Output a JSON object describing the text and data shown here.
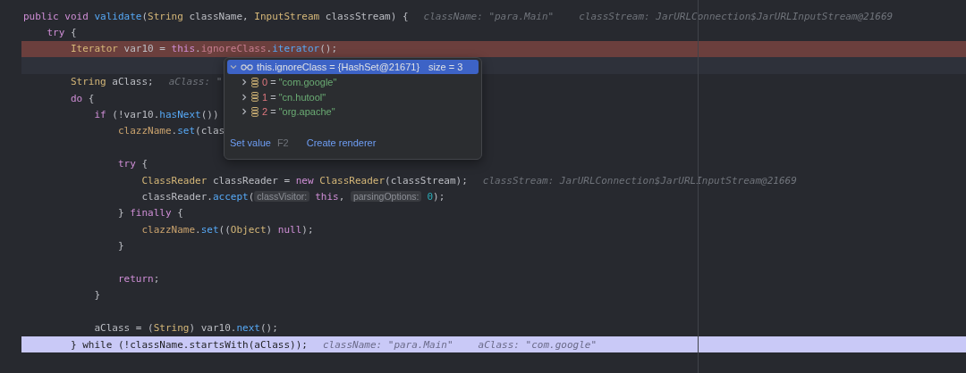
{
  "editor": {
    "lines": [
      {
        "kind": "code",
        "tokens": [
          {
            "kind": "keyword",
            "text": "public void "
          },
          {
            "kind": "method",
            "text": "validate"
          },
          {
            "kind": "plain",
            "text": "("
          },
          {
            "kind": "type",
            "text": "String"
          },
          {
            "kind": "plain",
            "text": " className, "
          },
          {
            "kind": "type",
            "text": "InputStream"
          },
          {
            "kind": "plain",
            "text": " classStream) {"
          }
        ],
        "hints": [
          "className: \"para.Main\"",
          "classStream: JarURLConnection$JarURLInputStream@21669"
        ],
        "children": [
          {
            "kind": "code",
            "tokens": [
              {
                "kind": "keyword",
                "text": "try"
              },
              {
                "kind": "plain",
                "text": " {"
              }
            ],
            "children": [
              {
                "kind": "breakpoint",
                "tokens": [
                  {
                    "kind": "type",
                    "text": "Iterator"
                  },
                  {
                    "kind": "plain",
                    "text": " var10 = "
                  },
                  {
                    "kind": "keyword",
                    "text": "this"
                  },
                  {
                    "kind": "plain",
                    "text": "."
                  },
                  {
                    "kind": "field",
                    "text": "ignoreClass"
                  },
                  {
                    "kind": "plain",
                    "text": "."
                  },
                  {
                    "kind": "method",
                    "text": "iterator"
                  },
                  {
                    "kind": "plain",
                    "text": "();"
                  }
                ]
              },
              {
                "kind": "current"
              },
              {
                "kind": "code",
                "tokens": [
                  {
                    "kind": "type",
                    "text": "String"
                  },
                  {
                    "kind": "plain",
                    "text": " aClass;"
                  }
                ],
                "hints": [
                  "aClass: \""
                ]
              },
              {
                "kind": "code",
                "tokens": [
                  {
                    "kind": "keyword",
                    "text": "do"
                  },
                  {
                    "kind": "plain",
                    "text": " {"
                  }
                ],
                "children": [
                  {
                    "kind": "code",
                    "tokens": [
                      {
                        "kind": "keyword",
                        "text": "if"
                      },
                      {
                        "kind": "plain",
                        "text": " (!var10."
                      },
                      {
                        "kind": "method",
                        "text": "hasNext"
                      },
                      {
                        "kind": "plain",
                        "text": "())"
                      }
                    ],
                    "children": [
                      {
                        "kind": "code",
                        "tokens": [
                          {
                            "kind": "static",
                            "text": "clazzName"
                          },
                          {
                            "kind": "plain",
                            "text": "."
                          },
                          {
                            "kind": "method",
                            "text": "set"
                          },
                          {
                            "kind": "plain",
                            "text": "(clas"
                          }
                        ]
                      },
                      {
                        "kind": "blank"
                      },
                      {
                        "kind": "code",
                        "tokens": [
                          {
                            "kind": "keyword",
                            "text": "try"
                          },
                          {
                            "kind": "plain",
                            "text": " {"
                          }
                        ],
                        "children": [
                          {
                            "kind": "code",
                            "tokens": [
                              {
                                "kind": "type",
                                "text": "ClassReader"
                              },
                              {
                                "kind": "plain",
                                "text": " classReader = "
                              },
                              {
                                "kind": "keyword",
                                "text": "new "
                              },
                              {
                                "kind": "type",
                                "text": "ClassReader"
                              },
                              {
                                "kind": "plain",
                                "text": "(classStream);"
                              }
                            ],
                            "hints": [
                              "classStream: JarURLConnection$JarURLInputStream@21669"
                            ]
                          },
                          {
                            "kind": "code",
                            "tokens": [
                              {
                                "kind": "plain",
                                "text": "classReader."
                              },
                              {
                                "kind": "method",
                                "text": "accept"
                              },
                              {
                                "kind": "plain",
                                "text": "("
                              },
                              {
                                "kind": "inlay",
                                "text": "classVisitor:"
                              },
                              {
                                "kind": "keyword",
                                "text": "this"
                              },
                              {
                                "kind": "plain",
                                "text": ", "
                              },
                              {
                                "kind": "inlay",
                                "text": "parsingOptions:"
                              },
                              {
                                "kind": "number",
                                "text": "0"
                              },
                              {
                                "kind": "plain",
                                "text": ");"
                              }
                            ]
                          }
                        ]
                      },
                      {
                        "kind": "code",
                        "tokens": [
                          {
                            "kind": "plain",
                            "text": "} "
                          },
                          {
                            "kind": "keyword",
                            "text": "finally"
                          },
                          {
                            "kind": "plain",
                            "text": " {"
                          }
                        ],
                        "children": [
                          {
                            "kind": "code",
                            "tokens": [
                              {
                                "kind": "static",
                                "text": "clazzName"
                              },
                              {
                                "kind": "plain",
                                "text": "."
                              },
                              {
                                "kind": "method",
                                "text": "set"
                              },
                              {
                                "kind": "plain",
                                "text": "(("
                              },
                              {
                                "kind": "type",
                                "text": "Object"
                              },
                              {
                                "kind": "plain",
                                "text": ") "
                              },
                              {
                                "kind": "keyword",
                                "text": "null"
                              },
                              {
                                "kind": "plain",
                                "text": ");"
                              }
                            ]
                          }
                        ]
                      },
                      {
                        "kind": "code",
                        "tokens": [
                          {
                            "kind": "plain",
                            "text": "}"
                          }
                        ]
                      },
                      {
                        "kind": "blank"
                      },
                      {
                        "kind": "code",
                        "tokens": [
                          {
                            "kind": "keyword",
                            "text": "return"
                          },
                          {
                            "kind": "plain",
                            "text": ";"
                          }
                        ]
                      }
                    ]
                  },
                  {
                    "kind": "code",
                    "tokens": [
                      {
                        "kind": "plain",
                        "text": "}"
                      }
                    ]
                  },
                  {
                    "kind": "blank"
                  },
                  {
                    "kind": "code",
                    "tokens": [
                      {
                        "kind": "plain",
                        "text": "aClass = ("
                      },
                      {
                        "kind": "type",
                        "text": "String"
                      },
                      {
                        "kind": "plain",
                        "text": ") var10."
                      },
                      {
                        "kind": "method",
                        "text": "next"
                      },
                      {
                        "kind": "plain",
                        "text": "();"
                      }
                    ]
                  }
                ]
              },
              {
                "kind": "execution",
                "tokens": [
                  {
                    "kind": "plain",
                    "text": "} while (!className.startsWith(aClass));"
                  }
                ],
                "hints": [
                  "className: \"para.Main\"",
                  "aClass: \"com.google\""
                ]
              }
            ]
          }
        ]
      }
    ]
  },
  "popup": {
    "header": {
      "expression": "this.ignoreClass = {HashSet@21671}",
      "size": "size = 3",
      "expanded": true,
      "selected": true
    },
    "items": [
      {
        "index": "0",
        "operator": "=",
        "value": "\"com.google\"",
        "expanded": false
      },
      {
        "index": "1",
        "operator": "=",
        "value": "\"cn.hutool\"",
        "expanded": false
      },
      {
        "index": "2",
        "operator": "=",
        "value": "\"org.apache\"",
        "expanded": false
      }
    ],
    "actions": [
      {
        "label": "Set value",
        "shortcut": "F2"
      },
      {
        "label": "Create renderer"
      }
    ]
  }
}
